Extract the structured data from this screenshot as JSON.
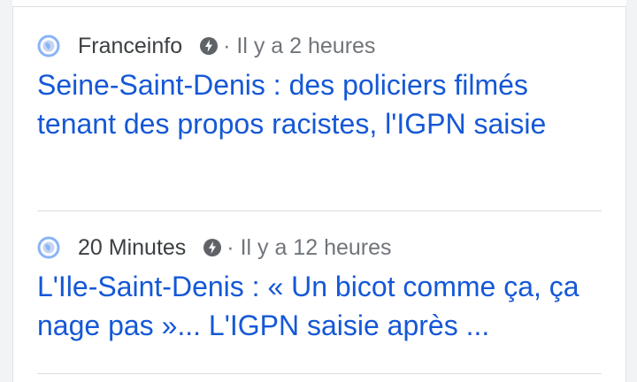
{
  "colors": {
    "headline": "#1558d6",
    "source": "#3c4043",
    "time": "#70757a",
    "divider": "#dadce0"
  },
  "stories": [
    {
      "source_icon": "globe-icon",
      "source": "Franceinfo",
      "amp_icon": "amp-lightning-icon",
      "time": "· Il y a 2 heures",
      "headline": "Seine-Saint-Denis : des policiers filmés tenant des propos racistes, l'IGPN saisie"
    },
    {
      "source_icon": "globe-icon",
      "source": "20 Minutes",
      "amp_icon": "amp-lightning-icon",
      "time": "· Il y a 12 heures",
      "headline": "L'Ile-Saint-Denis : « Un bicot comme ça, ça nage pas »... L'IGPN saisie après ..."
    }
  ]
}
